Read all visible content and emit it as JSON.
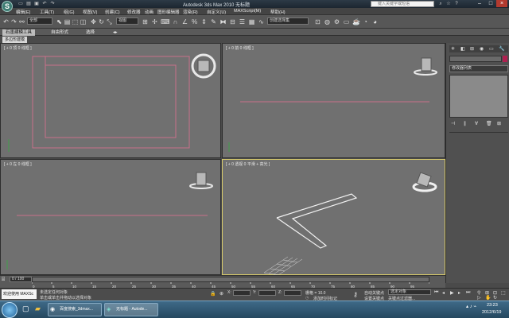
{
  "window": {
    "title": "Autodesk 3ds Max  2010    无标题",
    "search_placeholder": "键入关键字或短语",
    "logo": "S"
  },
  "menu": [
    "编辑(E)",
    "工具(T)",
    "组(G)",
    "视图(V)",
    "创建(C)",
    "修改器",
    "动画",
    "图形编辑器",
    "渲染(R)",
    "自定义(U)",
    "MAXScript(M)",
    "帮助(H)"
  ],
  "toolbar": {
    "selection_filter": "全部",
    "ref_coord": "视图",
    "named_selection": "创建选择集"
  },
  "ribbon": {
    "tabs": [
      "石墨建模工具",
      "自由形式",
      "选择"
    ],
    "subtab": "多边形建模"
  },
  "viewports": {
    "top": "[ + 0 顶 0 线框 ]",
    "front": "[ + 0 前 0 线框 ]",
    "left": "[ + 0 左 0 线框 ]",
    "persp": "[ + 0 透视 0 平滑 + 高光 ]"
  },
  "command_panel": {
    "modifier_list": "修改器列表"
  },
  "timeline": {
    "frame": "0 / 100",
    "ticks": [
      "0",
      "5",
      "10",
      "15",
      "20",
      "25",
      "30",
      "35",
      "40",
      "45",
      "50",
      "55",
      "60",
      "65",
      "70",
      "75",
      "80",
      "85",
      "90",
      "95",
      "100"
    ]
  },
  "status": {
    "welcome": "欢迎使用  MAXSc",
    "prompt1": "未选定任何对象",
    "prompt2": "单击或单击并拖动以选择对象",
    "x_label": "X:",
    "y_label": "Y:",
    "z_label": "Z:",
    "grid": "栅格 = 10.0",
    "add_time_tag": "添加时间标记",
    "auto_key": "自动关键点",
    "set_key": "设置关键点",
    "selected_obj": "选定对象",
    "key_filters": "关键点过滤器..."
  },
  "taskbar": {
    "items": [
      "百度搜索_3dmax...",
      "无标题 - Autode..."
    ],
    "time": "23:23",
    "date": "2012/6/19"
  },
  "colors": {
    "viewport_bg": "#707070",
    "shape_line": "#c8708a",
    "persp_line": "#f2f2f2",
    "active_border": "#d5c86a"
  }
}
